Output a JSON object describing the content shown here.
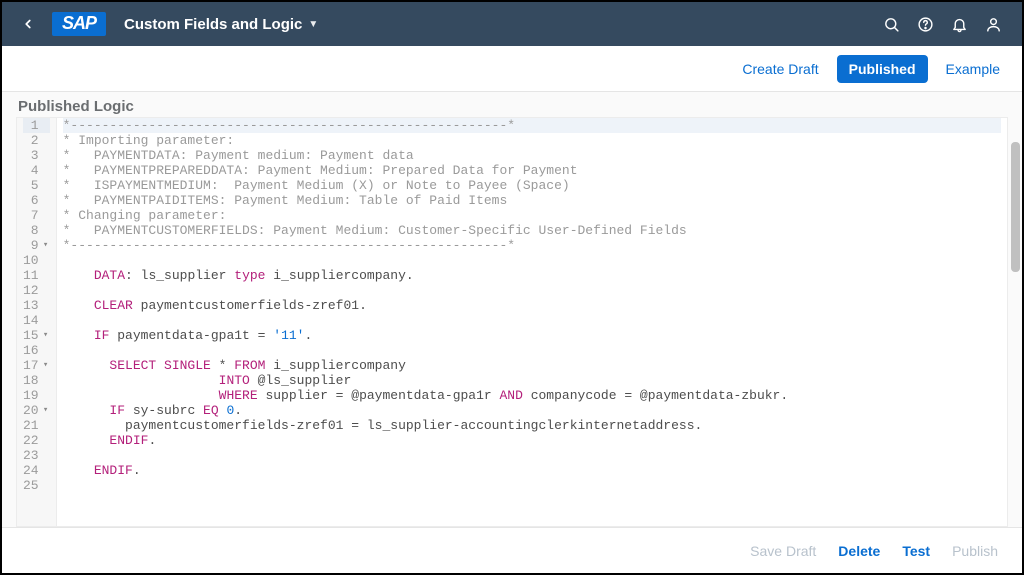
{
  "shell": {
    "logo_text": "SAP",
    "title": "Custom Fields and Logic"
  },
  "action_bar": {
    "create_draft": "Create Draft",
    "published": "Published",
    "example": "Example"
  },
  "section": {
    "title": "Published Logic"
  },
  "code": {
    "lines": [
      {
        "n": 1,
        "fold": "",
        "hl": true,
        "tokens": [
          [
            "comment",
            "*--------------------------------------------------------*"
          ]
        ]
      },
      {
        "n": 2,
        "fold": "",
        "hl": false,
        "tokens": [
          [
            "comment",
            "* Importing parameter:"
          ]
        ]
      },
      {
        "n": 3,
        "fold": "",
        "hl": false,
        "tokens": [
          [
            "comment",
            "*   PAYMENTDATA: Payment medium: Payment data"
          ]
        ]
      },
      {
        "n": 4,
        "fold": "",
        "hl": false,
        "tokens": [
          [
            "comment",
            "*   PAYMENTPREPAREDDATA: Payment Medium: Prepared Data for Payment"
          ]
        ]
      },
      {
        "n": 5,
        "fold": "",
        "hl": false,
        "tokens": [
          [
            "comment",
            "*   ISPAYMENTMEDIUM:  Payment Medium (X) or Note to Payee (Space)"
          ]
        ]
      },
      {
        "n": 6,
        "fold": "",
        "hl": false,
        "tokens": [
          [
            "comment",
            "*   PAYMENTPAIDITEMS: Payment Medium: Table of Paid Items"
          ]
        ]
      },
      {
        "n": 7,
        "fold": "",
        "hl": false,
        "tokens": [
          [
            "comment",
            "* Changing parameter:"
          ]
        ]
      },
      {
        "n": 8,
        "fold": "",
        "hl": false,
        "tokens": [
          [
            "comment",
            "*   PAYMENTCUSTOMERFIELDS: Payment Medium: Customer-Specific User-Defined Fields"
          ]
        ]
      },
      {
        "n": 9,
        "fold": "▾",
        "hl": false,
        "tokens": [
          [
            "comment",
            "*--------------------------------------------------------*"
          ]
        ]
      },
      {
        "n": 10,
        "fold": "",
        "hl": false,
        "tokens": [
          [
            "plain",
            ""
          ]
        ]
      },
      {
        "n": 11,
        "fold": "",
        "hl": false,
        "tokens": [
          [
            "plain",
            "    "
          ],
          [
            "kw",
            "DATA"
          ],
          [
            "plain",
            ": ls_supplier "
          ],
          [
            "kw",
            "type"
          ],
          [
            "plain",
            " i_suppliercompany."
          ]
        ]
      },
      {
        "n": 12,
        "fold": "",
        "hl": false,
        "tokens": [
          [
            "plain",
            ""
          ]
        ]
      },
      {
        "n": 13,
        "fold": "",
        "hl": false,
        "tokens": [
          [
            "plain",
            "    "
          ],
          [
            "kw",
            "CLEAR"
          ],
          [
            "plain",
            " paymentcustomerfields-zref01."
          ]
        ]
      },
      {
        "n": 14,
        "fold": "",
        "hl": false,
        "tokens": [
          [
            "plain",
            ""
          ]
        ]
      },
      {
        "n": 15,
        "fold": "▾",
        "hl": false,
        "tokens": [
          [
            "plain",
            "    "
          ],
          [
            "kw",
            "IF"
          ],
          [
            "plain",
            " paymentdata-gpa1t = "
          ],
          [
            "str",
            "'11'"
          ],
          [
            "plain",
            "."
          ]
        ]
      },
      {
        "n": 16,
        "fold": "",
        "hl": false,
        "tokens": [
          [
            "plain",
            ""
          ]
        ]
      },
      {
        "n": 17,
        "fold": "▾",
        "hl": false,
        "tokens": [
          [
            "plain",
            "      "
          ],
          [
            "kw",
            "SELECT SINGLE"
          ],
          [
            "plain",
            " * "
          ],
          [
            "kw",
            "FROM"
          ],
          [
            "plain",
            " i_suppliercompany"
          ]
        ]
      },
      {
        "n": 18,
        "fold": "",
        "hl": false,
        "tokens": [
          [
            "plain",
            "                    "
          ],
          [
            "kw",
            "INTO"
          ],
          [
            "plain",
            " @ls_supplier"
          ]
        ]
      },
      {
        "n": 19,
        "fold": "",
        "hl": false,
        "tokens": [
          [
            "plain",
            "                    "
          ],
          [
            "kw",
            "WHERE"
          ],
          [
            "plain",
            " supplier = @paymentdata-gpa1r "
          ],
          [
            "kw",
            "AND"
          ],
          [
            "plain",
            " companycode = @paymentdata-zbukr."
          ]
        ]
      },
      {
        "n": 20,
        "fold": "▾",
        "hl": false,
        "tokens": [
          [
            "plain",
            "      "
          ],
          [
            "kw",
            "IF"
          ],
          [
            "plain",
            " sy-subrc "
          ],
          [
            "kw",
            "EQ"
          ],
          [
            "plain",
            " "
          ],
          [
            "num",
            "0"
          ],
          [
            "plain",
            "."
          ]
        ]
      },
      {
        "n": 21,
        "fold": "",
        "hl": false,
        "tokens": [
          [
            "plain",
            "        paymentcustomerfields-zref01 = ls_supplier-accountingclerkinternetaddress."
          ]
        ]
      },
      {
        "n": 22,
        "fold": "",
        "hl": false,
        "tokens": [
          [
            "plain",
            "      "
          ],
          [
            "kw",
            "ENDIF"
          ],
          [
            "plain",
            "."
          ]
        ]
      },
      {
        "n": 23,
        "fold": "",
        "hl": false,
        "tokens": [
          [
            "plain",
            ""
          ]
        ]
      },
      {
        "n": 24,
        "fold": "",
        "hl": false,
        "tokens": [
          [
            "plain",
            "    "
          ],
          [
            "kw",
            "ENDIF"
          ],
          [
            "plain",
            "."
          ]
        ]
      },
      {
        "n": 25,
        "fold": "",
        "hl": false,
        "tokens": [
          [
            "plain",
            ""
          ]
        ]
      }
    ]
  },
  "footer": {
    "save_draft": "Save Draft",
    "delete": "Delete",
    "test": "Test",
    "publish": "Publish"
  }
}
